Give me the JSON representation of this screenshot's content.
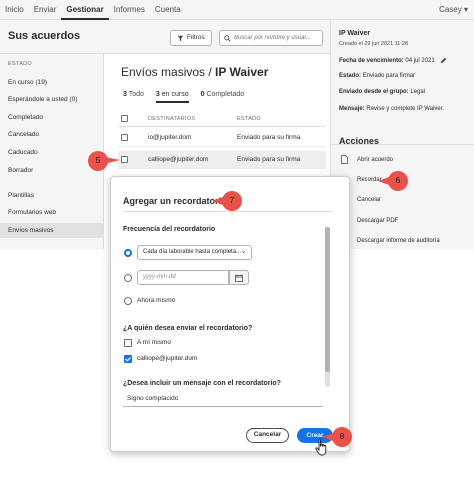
{
  "nav": {
    "items": [
      "Inicio",
      "Enviar",
      "Gestionar",
      "Informes",
      "Cuenta"
    ],
    "active_index": 2,
    "user": "Casey ▾"
  },
  "header": {
    "title": "Sus acuerdos",
    "filters_label": "Filtros",
    "search_placeholder": "Buscar por nombre y usuar..."
  },
  "sidebar": {
    "section_label": "ESTADO",
    "items": [
      {
        "label": "En curso (19)"
      },
      {
        "label": "Esperándole a usted (0)"
      },
      {
        "label": "Completado"
      },
      {
        "label": "Cancelado"
      },
      {
        "label": "Caducado"
      },
      {
        "label": "Borrador"
      },
      {
        "label": "Plantillas"
      },
      {
        "label": "Formularios web"
      },
      {
        "label": "Envíos masivos"
      }
    ]
  },
  "main": {
    "title_prefix": "Envíos masivos / ",
    "title_bold": "IP Waiver",
    "tabs": [
      {
        "count": "3",
        "label": " Todo"
      },
      {
        "count": "3",
        "label": " en curso"
      },
      {
        "count": "0",
        "label": " Completado"
      }
    ],
    "columns": [
      "DESTINATARIOS",
      "ESTADO"
    ],
    "rows": [
      {
        "recipient": "io@jupiter.dom",
        "status": "Enviado para su firma"
      },
      {
        "recipient": "calliope@jupiter.dom",
        "status": "Enviado para su firma"
      }
    ]
  },
  "details": {
    "title": "IP Waiver",
    "created": "Creado el 29 jun 2021 11:28",
    "expiry_label": "Fecha de vencimiento:",
    "expiry_value": "04 jul 2021",
    "state_label": "Estado:",
    "state_value": "Enviado para firmar",
    "group_label": "Enviado desde el grupo:",
    "group_value": "Legal",
    "message_label": "Mensaje:",
    "message_value": "Revise y complete IP Waiver.",
    "actions_title": "Acciones",
    "actions": [
      {
        "label": "Abrir acuerdo",
        "icon": "document-icon"
      },
      {
        "label": "Recordar",
        "icon": "bell-icon"
      },
      {
        "label": "Cancelar",
        "icon": ""
      },
      {
        "label": "Descargar PDF",
        "icon": ""
      },
      {
        "label": "Descargar informe de auditoría",
        "icon": ""
      }
    ]
  },
  "modal": {
    "title": "Agregar un recordatorio",
    "frequency_label": "Frecuencia del recordatorio",
    "frequency_select": "Cada día laborable hasta completa...",
    "date_placeholder": "yyyy-mm-dd",
    "now_label": "Ahora mismo",
    "who_label": "¿A quién desea enviar el recordatorio?",
    "who_options": [
      {
        "label": "A mí mismo",
        "checked": false
      },
      {
        "label": "calliope@jupiter.dom",
        "checked": true
      }
    ],
    "message_label": "¿Desea incluir un mensaje con el recordatorio?",
    "message_value": "Signo complacido",
    "cancel_label": "Cancelar",
    "create_label": "Crear"
  },
  "callouts": [
    "5",
    "6",
    "7",
    "8"
  ],
  "colors": {
    "accent": "#1473e6",
    "callout": "#e8524b"
  }
}
